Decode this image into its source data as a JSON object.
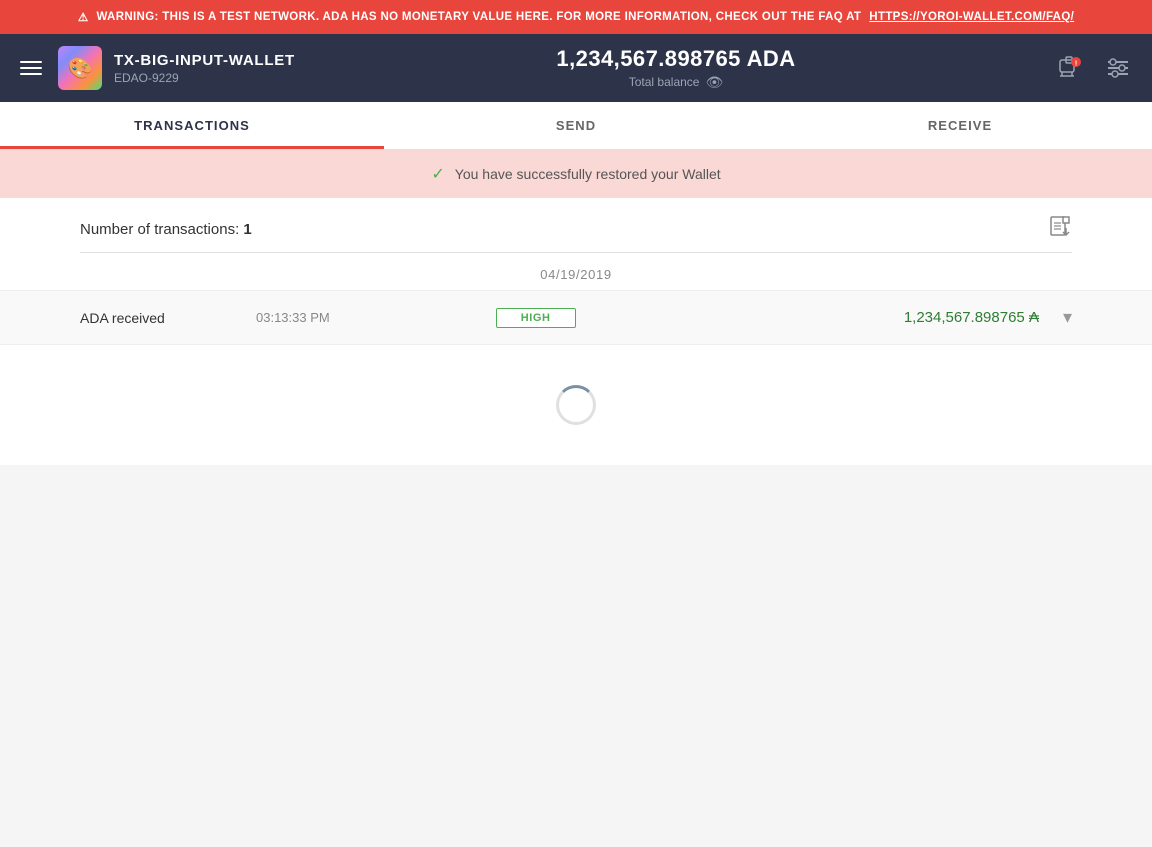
{
  "warning": {
    "text": "WARNING: THIS IS A TEST NETWORK. ADA HAS NO MONETARY VALUE HERE. FOR MORE INFORMATION, CHECK OUT THE FAQ AT ",
    "link_text": "HTTPS://YOROI-WALLET.COM/FAQ/",
    "link_url": "https://yoroi-wallet.com/faq/"
  },
  "header": {
    "wallet_name": "TX-BIG-INPUT-WALLET",
    "wallet_id": "EDAO-9229",
    "balance": "1,234,567.898765 ADA",
    "balance_label": "Total balance"
  },
  "tabs": [
    {
      "id": "transactions",
      "label": "TRANSACTIONS",
      "active": true
    },
    {
      "id": "send",
      "label": "SEND",
      "active": false
    },
    {
      "id": "receive",
      "label": "RECEIVE",
      "active": false
    }
  ],
  "success_banner": {
    "message": "You have successfully restored your Wallet"
  },
  "transactions": {
    "count_label": "Number of transactions:",
    "count": "1",
    "date": "04/19/2019",
    "items": [
      {
        "type": "ADA received",
        "time": "03:13:33 PM",
        "badge": "HIGH",
        "amount": "1,234,567.898765",
        "currency": "₳"
      }
    ]
  }
}
